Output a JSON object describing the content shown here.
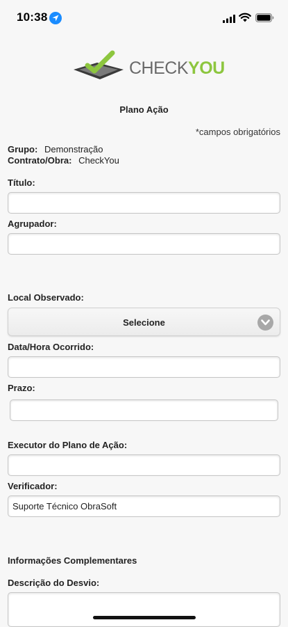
{
  "status_bar": {
    "time": "10:38",
    "icons": [
      "location-arrow-icon",
      "signal-icon",
      "wifi-icon",
      "battery-icon"
    ]
  },
  "logo": {
    "text_part1": "CHECK",
    "text_part2": "YOU",
    "colors": {
      "gray": "#6a6a6a",
      "green": "#8dc63f"
    }
  },
  "page": {
    "title": "Plano Ação",
    "required_note": "*campos obrigatórios"
  },
  "info": {
    "grupo_label": "Grupo:",
    "grupo_value": "Demonstração",
    "contrato_label": "Contrato/Obra:",
    "contrato_value": "CheckYou"
  },
  "form": {
    "titulo": {
      "label": "Título:",
      "value": ""
    },
    "agrupador": {
      "label": "Agrupador:",
      "value": ""
    },
    "local": {
      "label": "Local Observado:",
      "selected": "Selecione"
    },
    "data_hora": {
      "label": "Data/Hora Ocorrido:",
      "value": ""
    },
    "prazo": {
      "label": "Prazo:",
      "value": ""
    },
    "executor": {
      "label": "Executor do Plano de Ação:",
      "value": ""
    },
    "verificador": {
      "label": "Verificador:",
      "value": "Suporte Técnico ObraSoft"
    },
    "section_title": "Informações Complementares",
    "descricao": {
      "label": "Descrição do Desvio:",
      "value": ""
    }
  },
  "theme": {
    "background": "#f7f7f7",
    "accent_blue": "#1a8cff"
  }
}
